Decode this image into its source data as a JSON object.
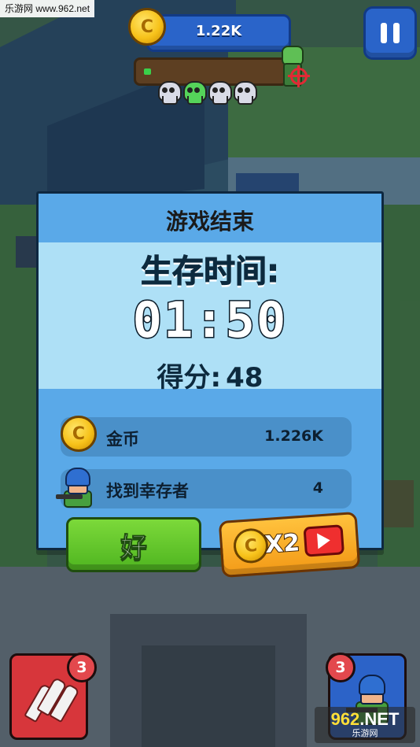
{
  "hud": {
    "watermark_top": "乐游网 www.962.net",
    "coins": "1.22K",
    "wave_progress": 0.05,
    "skulls": [
      {
        "icon": "skull-icon",
        "color": "#d9dbe6"
      },
      {
        "icon": "skull-icon",
        "color": "#55d35a"
      },
      {
        "icon": "skull-icon",
        "color": "#d9dbe6"
      },
      {
        "icon": "skull-icon",
        "color": "#d9dbe6"
      }
    ]
  },
  "dialog": {
    "title": "游戏结束",
    "survival_label": "生存时间:",
    "timer": "01:50",
    "score_label": "得分:",
    "score_value": "48",
    "rewards": [
      {
        "icon": "coin-icon",
        "label": "金币",
        "value": "1.226K"
      },
      {
        "icon": "survivor-icon",
        "label": "找到幸存者",
        "value": "4"
      }
    ],
    "ok_label": "好",
    "double_label": "X2"
  },
  "cards": {
    "rocket_count": "3",
    "survivor_count": "3"
  },
  "watermark_bottom": {
    "main_a": "962",
    "main_b": ".NET",
    "sub": "乐游网"
  },
  "colors": {
    "dialog_bg": "#5aa9e8",
    "band": "#aee0f6",
    "ok_green": "#5cc52a",
    "double_orange": "#f7a91f"
  }
}
